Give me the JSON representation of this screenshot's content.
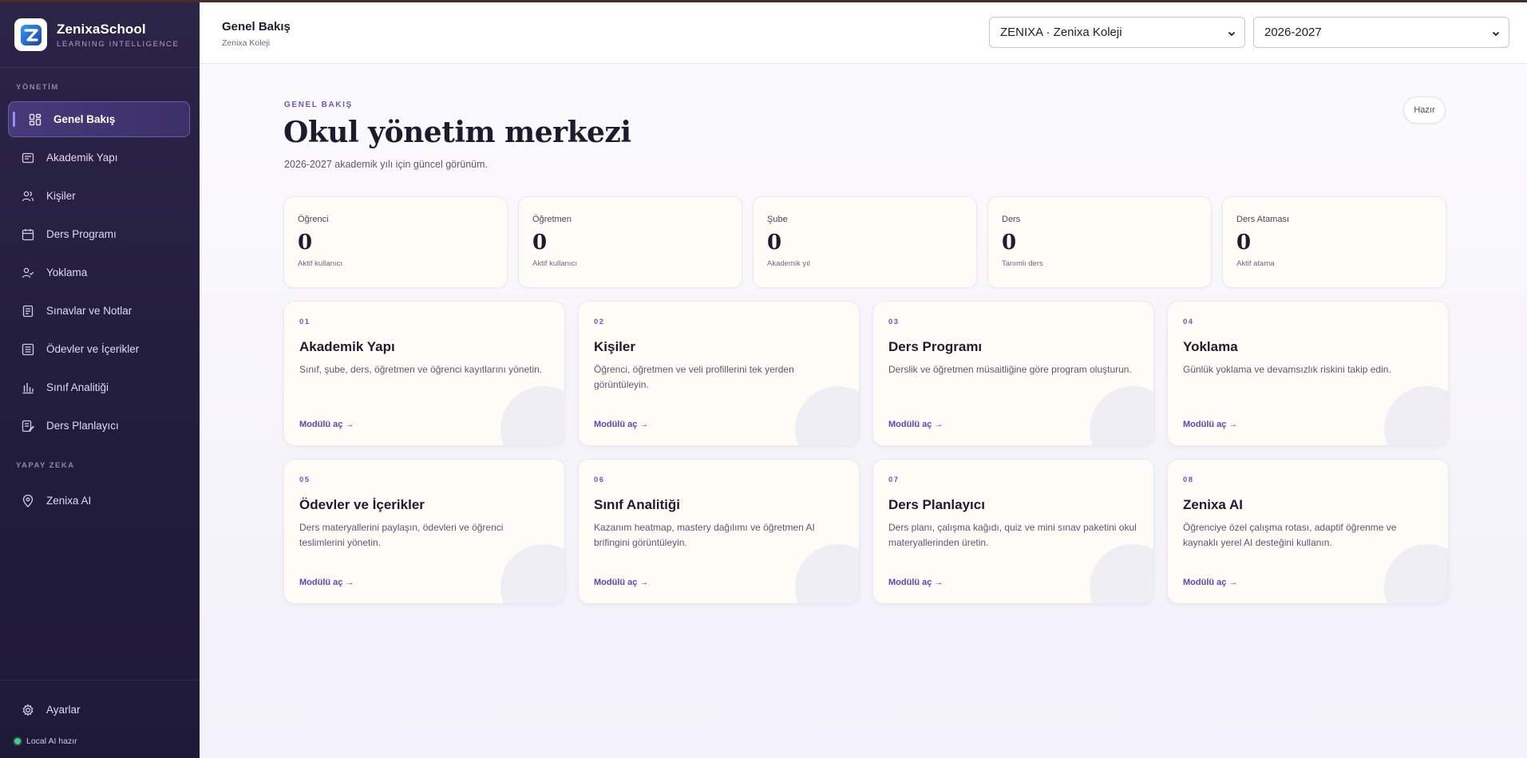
{
  "brand": {
    "name": "ZenixaSchool",
    "tagline": "LEARNING INTELLIGENCE",
    "logo_letter": "Z"
  },
  "sidebar": {
    "section_management": "YÖNETİM",
    "items": [
      {
        "label": "Genel Bakış",
        "icon": "dashboard-icon"
      },
      {
        "label": "Akademik Yapı",
        "icon": "layout-icon"
      },
      {
        "label": "Kişiler",
        "icon": "users-icon"
      },
      {
        "label": "Ders Programı",
        "icon": "calendar-icon"
      },
      {
        "label": "Yoklama",
        "icon": "user-check-icon"
      },
      {
        "label": "Sınavlar ve Notlar",
        "icon": "document-icon"
      },
      {
        "label": "Ödevler ve İçerikler",
        "icon": "list-icon"
      },
      {
        "label": "Sınıf Analitiği",
        "icon": "bar-chart-icon"
      },
      {
        "label": "Ders Planlayıcı",
        "icon": "planner-icon"
      }
    ],
    "section_ai": "YAPAY ZEKA",
    "ai_items": [
      {
        "label": "Zenixa AI",
        "icon": "location-pin-icon"
      }
    ],
    "settings_label": "Ayarlar",
    "ai_status": "Local AI hazır"
  },
  "topbar": {
    "title": "Genel Bakış",
    "subtitle": "Zenixa Koleji",
    "school_select": "ZENIXA · Zenixa Koleji",
    "year_select": "2026-2027"
  },
  "hero": {
    "eyebrow": "GENEL BAKIŞ",
    "title": "Okul yönetim merkezi",
    "subtitle": "2026-2027 akademik yılı için güncel görünüm.",
    "status_pill": "Hazır"
  },
  "stats": [
    {
      "label": "Öğrenci",
      "value": "0",
      "sub": "Aktif kullanıcı"
    },
    {
      "label": "Öğretmen",
      "value": "0",
      "sub": "Aktif kullanıcı"
    },
    {
      "label": "Şube",
      "value": "0",
      "sub": "Akademik yıl"
    },
    {
      "label": "Ders",
      "value": "0",
      "sub": "Tanımlı ders"
    },
    {
      "label": "Ders Ataması",
      "value": "0",
      "sub": "Aktif atama"
    }
  ],
  "modules": [
    {
      "num": "01",
      "title": "Akademik Yapı",
      "desc": "Sınıf, şube, ders, öğretmen ve öğrenci kayıtlarını yönetin.",
      "link": "Modülü aç →"
    },
    {
      "num": "02",
      "title": "Kişiler",
      "desc": "Öğrenci, öğretmen ve veli profillerini tek yerden görüntüleyin.",
      "link": "Modülü aç →"
    },
    {
      "num": "03",
      "title": "Ders Programı",
      "desc": "Derslik ve öğretmen müsaitliğine göre program oluşturun.",
      "link": "Modülü aç →"
    },
    {
      "num": "04",
      "title": "Yoklama",
      "desc": "Günlük yoklama ve devamsızlık riskini takip edin.",
      "link": "Modülü aç →"
    },
    {
      "num": "05",
      "title": "Ödevler ve İçerikler",
      "desc": "Ders materyallerini paylaşın, ödevleri ve öğrenci teslimlerini yönetin.",
      "link": "Modülü aç →"
    },
    {
      "num": "06",
      "title": "Sınıf Analitiği",
      "desc": "Kazanım heatmap, mastery dağılımı ve öğretmen AI brifingini görüntüleyin.",
      "link": "Modülü aç →"
    },
    {
      "num": "07",
      "title": "Ders Planlayıcı",
      "desc": "Ders planı, çalışma kağıdı, quiz ve mini sınav paketini okul materyallerinden üretin.",
      "link": "Modülü aç →"
    },
    {
      "num": "08",
      "title": "Zenixa AI",
      "desc": "Öğrenciye özel çalışma rotası, adaptif öğrenme ve kaynaklı yerel AI desteğini kullanın.",
      "link": "Modülü aç →"
    }
  ],
  "colors": {
    "accent": "#6b55d8",
    "sidebar_bg": "#231d3d",
    "card_bg": "#fffcf8",
    "status_ok": "#3ecf8e"
  }
}
